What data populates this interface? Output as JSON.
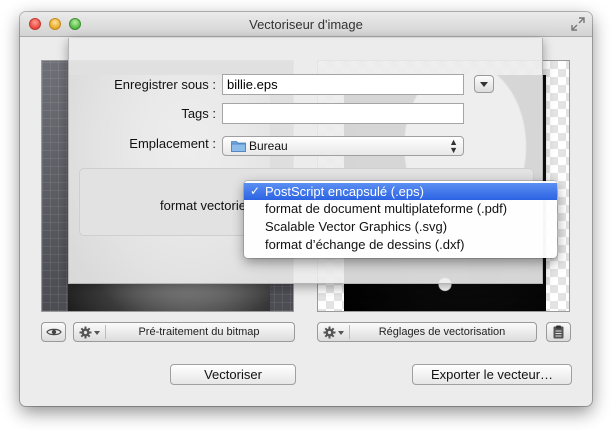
{
  "window": {
    "title": "Vectoriseur d'image"
  },
  "sheet": {
    "save_as_label": "Enregistrer sous :",
    "save_as_value": "billie.eps",
    "tags_label": "Tags :",
    "tags_value": "",
    "location_label": "Emplacement :",
    "location_value": "Bureau",
    "format_label": "format vectorie"
  },
  "format_menu": {
    "items": [
      "PostScript encapsulé (.eps)",
      "format de document multiplateforme (.pdf)",
      "Scalable Vector Graphics (.svg)",
      "format d’échange de dessins  (.dxf)"
    ],
    "selected_index": 0,
    "checkmark": "✓"
  },
  "toolbar": {
    "preprocess_label": "Pré-traitement du bitmap",
    "vector_settings_label": "Réglages de vectorisation"
  },
  "buttons": {
    "vectorize": "Vectoriser",
    "export": "Exporter le vecteur…"
  },
  "icons": {
    "eye": "eye-icon",
    "gear": "gear-icon",
    "clipboard": "clipboard-icon",
    "folder": "folder-icon",
    "fullscreen": "fullscreen-icon"
  },
  "colors": {
    "selection": "#2c63e3",
    "folder": "#6fa8e0"
  }
}
